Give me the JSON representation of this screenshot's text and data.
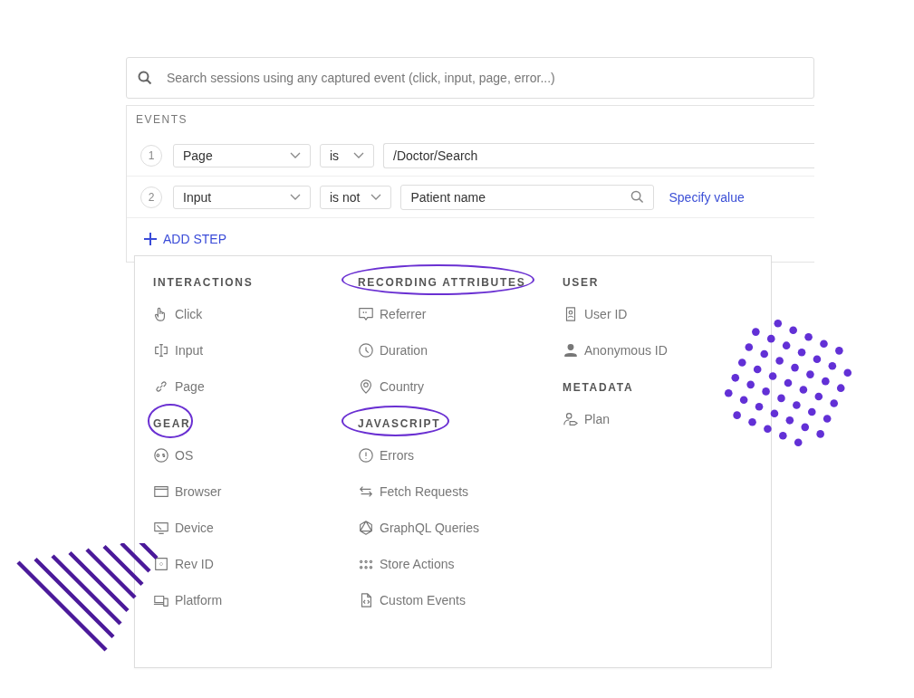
{
  "search": {
    "placeholder": "Search sessions using any captured event (click, input, page, error...)"
  },
  "events": {
    "title": "EVENTS",
    "add_step": "ADD STEP",
    "steps": [
      {
        "number": "1",
        "event": "Page",
        "operator": "is",
        "value": "/Doctor/Search"
      },
      {
        "number": "2",
        "event": "Input",
        "operator": "is not",
        "value": "Patient name",
        "link": "Specify value"
      }
    ]
  },
  "menu": {
    "columns": [
      [
        {
          "title": "INTERACTIONS",
          "highlighted": false,
          "items": [
            "Click",
            "Input",
            "Page"
          ]
        },
        {
          "title": "GEAR",
          "highlighted": true,
          "items": [
            "OS",
            "Browser",
            "Device",
            "Rev ID",
            "Platform"
          ]
        }
      ],
      [
        {
          "title": "RECORDING ATTRIBUTES",
          "highlighted": true,
          "items": [
            "Referrer",
            "Duration",
            "Country"
          ]
        },
        {
          "title": "JAVASCRIPT",
          "highlighted": true,
          "items": [
            "Errors",
            "Fetch Requests",
            "GraphQL Queries",
            "Store Actions",
            "Custom Events"
          ]
        }
      ],
      [
        {
          "title": "USER",
          "highlighted": false,
          "items": [
            "User ID",
            "Anonymous ID"
          ]
        },
        {
          "title": "METADATA",
          "highlighted": false,
          "items": [
            "Plan"
          ]
        }
      ]
    ]
  }
}
